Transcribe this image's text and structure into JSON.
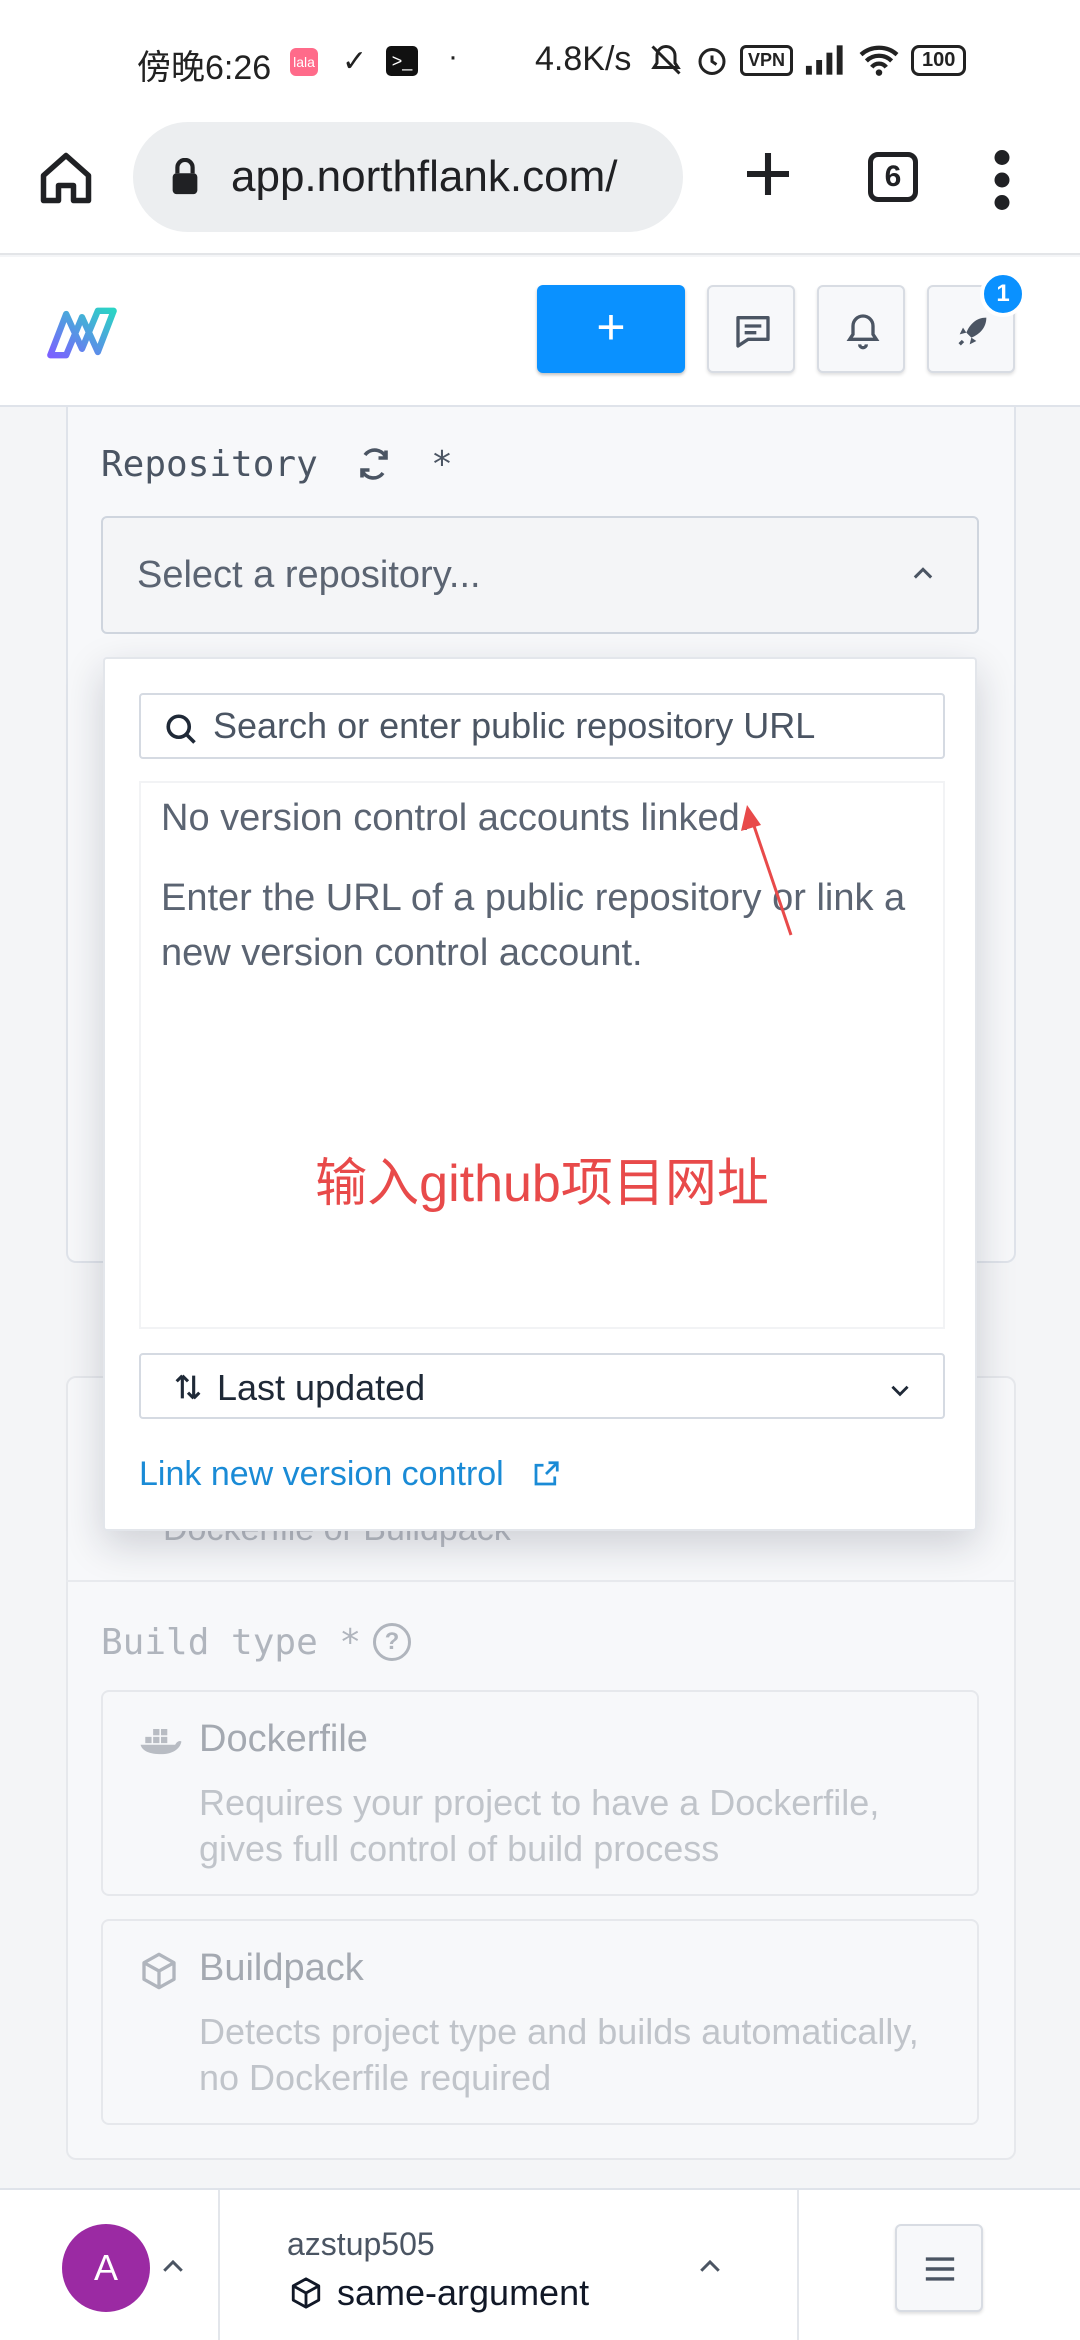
{
  "status_bar": {
    "time": "傍晚6:26",
    "app1": "lala",
    "app2": "✓",
    "app3": ">_",
    "dot": "·",
    "net_speed": "4.8K/s",
    "vpn": "VPN",
    "battery": "100"
  },
  "browser": {
    "url": "app.northflank.com/",
    "tab_count": "6"
  },
  "header": {
    "create_label": "+",
    "notification_count": "1"
  },
  "form": {
    "repository_label": "Repository",
    "required_mark": "*",
    "repository_placeholder": "Select a repository...",
    "dockerfile_hint": "Dockerfile or Buildpack",
    "build_type_label": "Build type *",
    "help": "?",
    "options": [
      {
        "title": "Dockerfile",
        "description": "Requires your project to have a Dockerfile, gives full control of build process"
      },
      {
        "title": "Buildpack",
        "description": "Detects project type and builds automatically, no Dockerfile required"
      }
    ]
  },
  "dropdown": {
    "search_placeholder": "Search or enter public repository URL",
    "message_none": "No version control accounts linked.",
    "message_hint": "Enter the URL of a public repository or link a new version control account.",
    "annotation": "输入github项目网址",
    "sort_label": "Last updated",
    "link_label": "Link new version control"
  },
  "bottom_bar": {
    "avatar_initial": "A",
    "org_name": "azstup505",
    "project_name": "same-argument"
  },
  "colors": {
    "accent": "#0a91ff",
    "link": "#1a8bd6",
    "avatar": "#9b2aa3",
    "annotation": "#e84a4a"
  }
}
